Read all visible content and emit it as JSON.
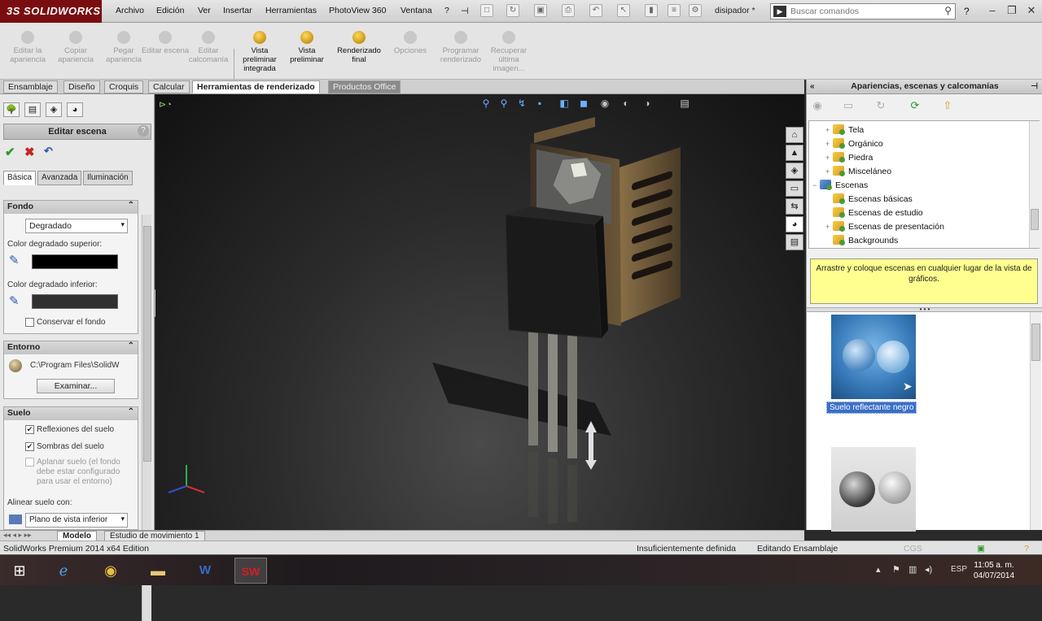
{
  "app": {
    "brand": "SOLIDWORKS",
    "document_name": "disipador *",
    "search_placeholder": "Buscar comandos"
  },
  "menu": [
    "Archivo",
    "Edición",
    "Ver",
    "Insertar",
    "Herramientas",
    "PhotoView 360",
    "Ventana",
    "?"
  ],
  "toolbar": {
    "items": [
      {
        "label": "Editar la apariencia",
        "enabled": false
      },
      {
        "label": "Copiar apariencia",
        "enabled": false
      },
      {
        "label": "Pegar apariencia",
        "enabled": false
      },
      {
        "label": "Editar escena",
        "enabled": false
      },
      {
        "label": "Editar calcomanía",
        "enabled": false
      },
      {
        "label": "Vista preliminar integrada",
        "enabled": true
      },
      {
        "label": "Vista preliminar",
        "enabled": true
      },
      {
        "label": "Renderizado final",
        "enabled": true
      },
      {
        "label": "Opciones",
        "enabled": false
      },
      {
        "label": "Programar renderizado",
        "enabled": false
      },
      {
        "label": "Recuperar última imagen...",
        "enabled": false
      }
    ]
  },
  "tabs": [
    {
      "label": "Ensamblaje",
      "state": "normal"
    },
    {
      "label": "Diseño",
      "state": "normal"
    },
    {
      "label": "Croquis",
      "state": "normal"
    },
    {
      "label": "Calcular",
      "state": "normal"
    },
    {
      "label": "Herramientas de renderizado",
      "state": "active"
    },
    {
      "label": "Productos Office",
      "state": "disabled"
    }
  ],
  "property_manager": {
    "title": "Editar escena",
    "subtabs": [
      "Básica",
      "Avanzada",
      "Iluminación"
    ],
    "fondo": {
      "header": "Fondo",
      "type_value": "Degradado",
      "top_color_label": "Color degradado superior:",
      "top_color": "#000000",
      "bottom_color_label": "Color degradado inferior:",
      "bottom_color": "#303030",
      "keep_background_label": "Conservar el fondo",
      "keep_background_checked": false
    },
    "entorno": {
      "header": "Entorno",
      "path": "C:\\Program Files\\SolidW",
      "browse_label": "Examinar..."
    },
    "suelo": {
      "header": "Suelo",
      "reflections_label": "Reflexiones del suelo",
      "reflections_checked": true,
      "shadows_label": "Sombras del suelo",
      "shadows_checked": true,
      "flatten_label": "Aplanar suelo (el fondo debe estar configurado para usar el entorno)",
      "flatten_enabled": false,
      "align_label": "Alinear suelo con:",
      "align_value": "Plano de vista inferior"
    }
  },
  "task_pane": {
    "title": "Apariencias, escenas y calcomanías",
    "tree": [
      {
        "label": "Tela",
        "level": 1,
        "expandable": true
      },
      {
        "label": "Orgánico",
        "level": 1,
        "expandable": true
      },
      {
        "label": "Piedra",
        "level": 1,
        "expandable": true
      },
      {
        "label": "Misceláneo",
        "level": 1,
        "expandable": true
      },
      {
        "label": "Escenas",
        "level": 0,
        "expandable": true
      },
      {
        "label": "Escenas básicas",
        "level": 1,
        "expandable": false
      },
      {
        "label": "Escenas de estudio",
        "level": 1,
        "expandable": false
      },
      {
        "label": "Escenas de presentación",
        "level": 1,
        "expandable": true
      },
      {
        "label": "Backgrounds",
        "level": 1,
        "expandable": false
      }
    ],
    "tip": "Arrastre y coloque escenas en cualquier lugar de la vista de gráficos.",
    "gallery": [
      {
        "label": "Suelo reflectante negro",
        "selected": true
      },
      {
        "label": "",
        "selected": false
      }
    ]
  },
  "bottom_tabs": [
    "Modelo",
    "Estudio de movimiento 1"
  ],
  "status": {
    "edition": "SolidWorks Premium 2014 x64 Edition",
    "definition": "Insuficientemente definida",
    "mode": "Editando Ensamblaje",
    "units": "CGS"
  },
  "taskbar": {
    "lang": "ESP",
    "time": "11:05 a. m.",
    "date": "04/07/2014"
  },
  "colors": {
    "accent_selection": "#3a6fc8",
    "brand_red": "#7a0d10",
    "tip_background": "#ffff90"
  }
}
